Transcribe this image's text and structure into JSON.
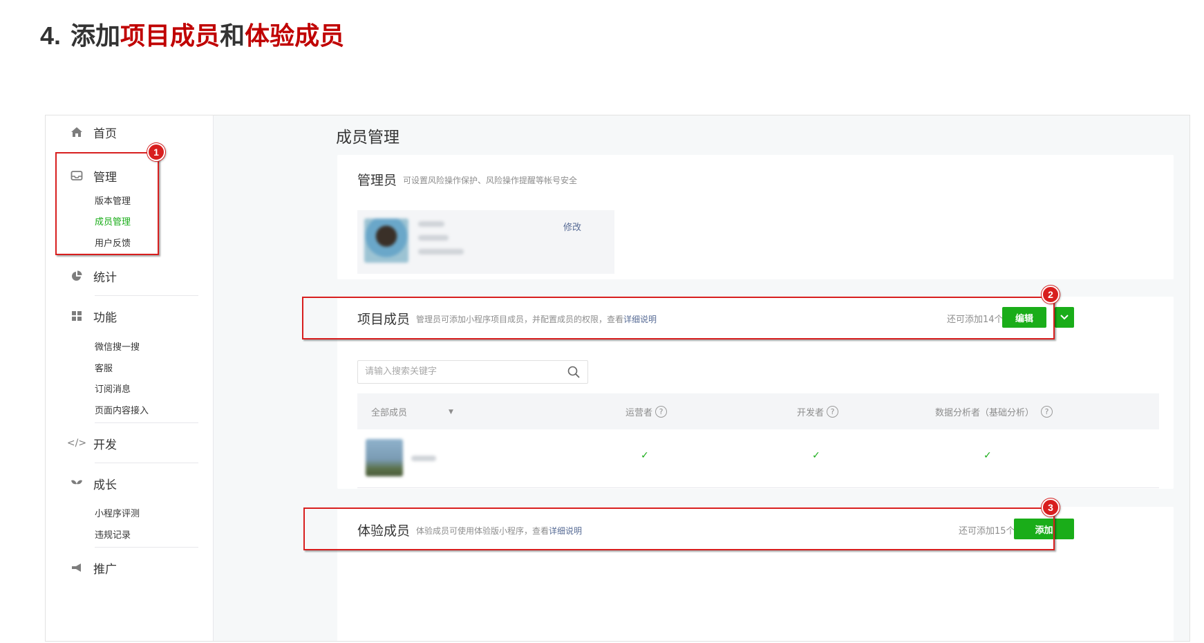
{
  "heading": {
    "number": "4.",
    "part1": "添加",
    "part2": "项目成员",
    "part3": "和",
    "part4": "体验成员"
  },
  "sidebar": {
    "home": "首页",
    "manage": "管理",
    "manage_items": [
      "版本管理",
      "成员管理",
      "用户反馈"
    ],
    "stats": "统计",
    "features": "功能",
    "features_items": [
      "微信搜一搜",
      "客服",
      "订阅消息",
      "页面内容接入"
    ],
    "develop": "开发",
    "grow": "成长",
    "grow_items": [
      "小程序评测",
      "违规记录"
    ],
    "promote": "推广"
  },
  "main": {
    "page_title": "成员管理",
    "admin": {
      "title": "管理员",
      "desc": "可设置风险操作保护、风险操作提醒等帐号安全",
      "edit_link": "修改"
    },
    "project": {
      "title": "项目成员",
      "desc": "管理员可添加小程序项目成员，并配置成员的权限，查看",
      "desc_link": "详细说明",
      "quota": "还可添加14个",
      "edit_button": "编辑",
      "search_placeholder": "请输入搜索关键字",
      "columns": [
        "全部成员",
        "运营者",
        "开发者",
        "数据分析者（基础分析）"
      ],
      "row_checks": [
        "✓",
        "✓",
        "✓"
      ]
    },
    "experience": {
      "title": "体验成员",
      "desc": "体验成员可使用体验版小程序，查看",
      "desc_link": "详细说明",
      "quota": "还可添加15个",
      "add_button": "添加"
    }
  },
  "annotations": {
    "badge1": "1",
    "badge2": "2",
    "badge3": "3",
    "color": "#d81e1e"
  },
  "colors": {
    "accent": "#1aad19",
    "link": "#576b95",
    "heading_red": "#c00000"
  }
}
